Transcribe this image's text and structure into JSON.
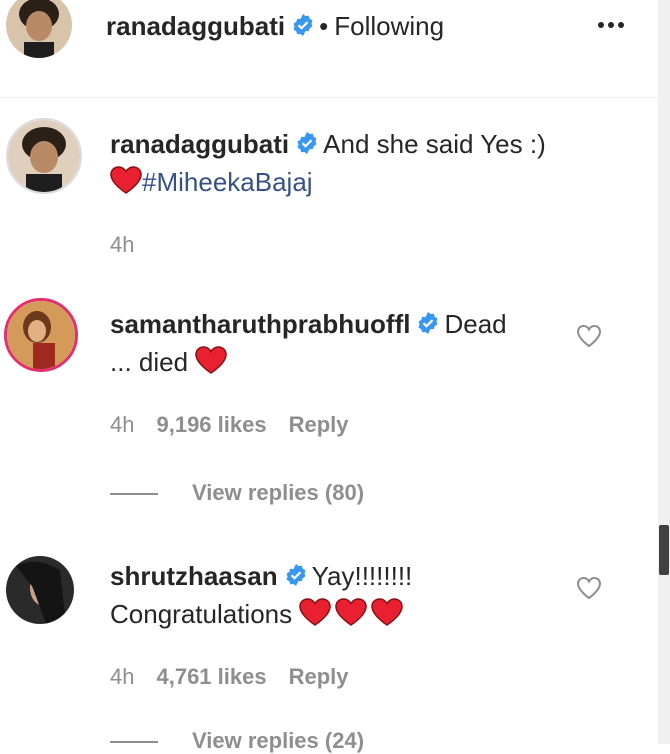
{
  "header": {
    "username": "ranadaggubati",
    "separator": "•",
    "follow_status": "Following",
    "more_icon": "more-horizontal-icon"
  },
  "caption": {
    "username": "ranadaggubati",
    "text": "And she said Yes :)",
    "hashtag": "#MiheekaBajaj",
    "time": "4h"
  },
  "comments": [
    {
      "username": "samantharuthprabhuoffl",
      "text_line1": "Dead",
      "text_line2": "... died",
      "time": "4h",
      "likes": "9,196 likes",
      "reply": "Reply",
      "view_replies": "View replies (80)"
    },
    {
      "username": "shrutzhaasan",
      "text_line1": "Yay!!!!!!!!",
      "text_line2": "Congratulations",
      "time": "4h",
      "likes": "4,761 likes",
      "reply": "Reply",
      "view_replies": "View replies (24)"
    }
  ],
  "colors": {
    "link": "#385185",
    "verified": "#3897f0",
    "muted": "#8e8e8e",
    "heart_red": "#ed4956"
  }
}
